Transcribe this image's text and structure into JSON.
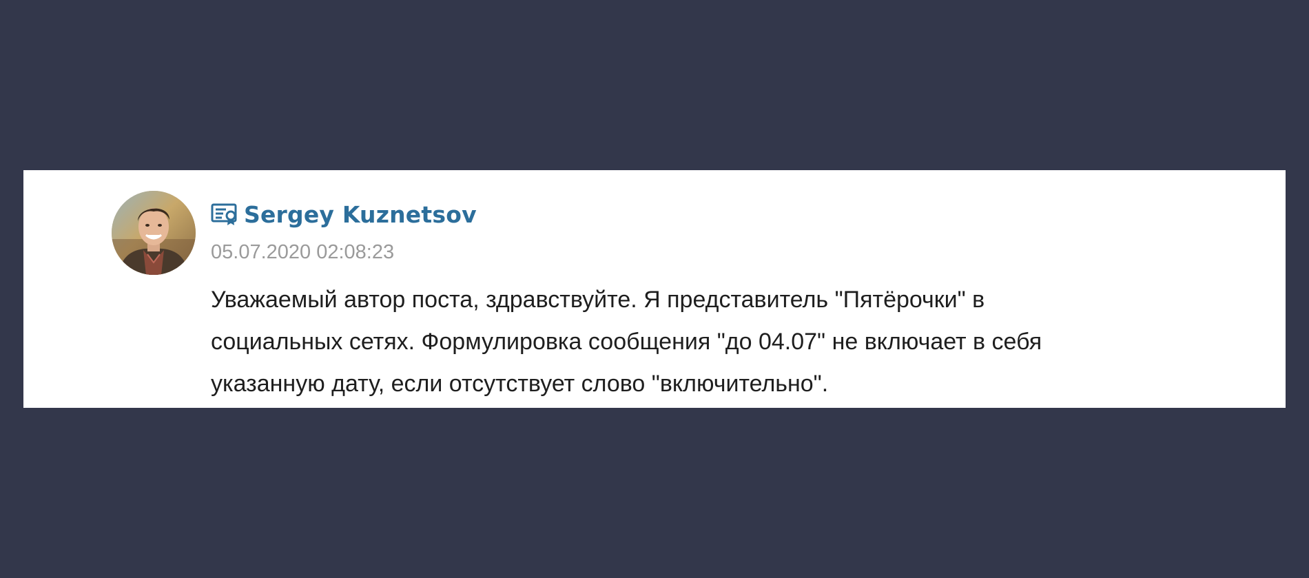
{
  "comment": {
    "author_name": "Sergey Kuznetsov",
    "author_badge_icon": "verified-certificate-icon",
    "timestamp": "05.07.2020 02:08:23",
    "text_lines": [
      "Уважаемый автор поста, здравствуйте. Я представитель \"Пятёрочки\" в",
      "социальных сетях. Формулировка сообщения \"до 04.07\" не включает в себя",
      "указанную дату, если отсутствует слово \"включительно\"."
    ]
  },
  "colors": {
    "page_background": "#33374b",
    "card_background": "#ffffff",
    "author_name": "#2c6e9b",
    "timestamp": "#9a9a9a",
    "message_text": "#1e1e1e"
  }
}
